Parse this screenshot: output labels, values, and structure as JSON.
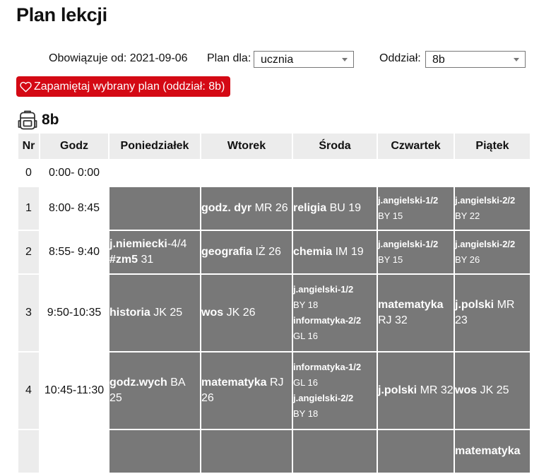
{
  "page": {
    "title": "Plan lekcji"
  },
  "controls": {
    "validity": "Obowiązuje od: 2021-09-06",
    "plan_for_label": "Plan dla:",
    "plan_for_value": "ucznia",
    "division_label": "Oddział:",
    "division_value": "8b",
    "save_button": "Zapamiętaj wybrany plan (oddział: 8b)"
  },
  "class_name": "8b",
  "colors": {
    "accent": "#d40914",
    "lesson_bg": "#787878",
    "header_bg": "#ececec"
  },
  "table": {
    "headers": [
      "Nr",
      "Godz",
      "Poniedziałek",
      "Wtorek",
      "Środa",
      "Czwartek",
      "Piątek"
    ],
    "rows": [
      {
        "nr": "0",
        "hours": "0:00- 0:00",
        "cells": [
          [],
          [],
          [],
          [],
          []
        ]
      },
      {
        "nr": "1",
        "hours": "8:00- 8:45",
        "cells": [
          [],
          [
            {
              "subject": "godz. dyr",
              "info": "MR 26"
            }
          ],
          [
            {
              "subject": "religia",
              "info": "BU 19"
            }
          ],
          [
            {
              "subject": "j.angielski-1/2",
              "info": "BY 15"
            }
          ],
          [
            {
              "subject": "j.angielski-2/2",
              "info": "BY 22"
            }
          ]
        ]
      },
      {
        "nr": "2",
        "hours": "8:55- 9:40",
        "cells": [
          [
            {
              "subject": "j.niemiecki",
              "suffix": "-4/4",
              "group": "#zm5",
              "info": "31"
            }
          ],
          [
            {
              "subject": "geografia",
              "info": "IŻ 26"
            }
          ],
          [
            {
              "subject": "chemia",
              "info": "IM 19"
            }
          ],
          [
            {
              "subject": "j.angielski-1/2",
              "info": "BY 15"
            }
          ],
          [
            {
              "subject": "j.angielski-2/2",
              "info": "BY 26"
            }
          ]
        ]
      },
      {
        "nr": "3",
        "hours": "9:50-10:35",
        "cells": [
          [
            {
              "subject": "historia",
              "info": "JK 25"
            }
          ],
          [
            {
              "subject": "wos",
              "info": "JK 26"
            }
          ],
          [
            {
              "subject": "j.angielski-1/2",
              "info": "BY 18"
            },
            {
              "subject": "informatyka-2/2",
              "info": "GL 16"
            }
          ],
          [
            {
              "subject": "matematyka",
              "info": "RJ 32"
            }
          ],
          [
            {
              "subject": "j.polski",
              "info": "MR 23"
            }
          ]
        ]
      },
      {
        "nr": "4",
        "hours": "10:45-11:30",
        "cells": [
          [
            {
              "subject": "godz.wych",
              "info": "BA 25"
            }
          ],
          [
            {
              "subject": "matematyka",
              "info": "RJ 26"
            }
          ],
          [
            {
              "subject": "informatyka-1/2",
              "info": "GL 16"
            },
            {
              "subject": "j.angielski-2/2",
              "info": "BY 18"
            }
          ],
          [
            {
              "subject": "j.polski",
              "info": "MR 32"
            }
          ],
          [
            {
              "subject": "wos",
              "info": "JK 25"
            }
          ]
        ]
      },
      {
        "nr": "",
        "hours": "",
        "cells": [
          [],
          [],
          [],
          [],
          [
            {
              "subject": "matematyka",
              "info": ""
            }
          ]
        ]
      }
    ]
  }
}
